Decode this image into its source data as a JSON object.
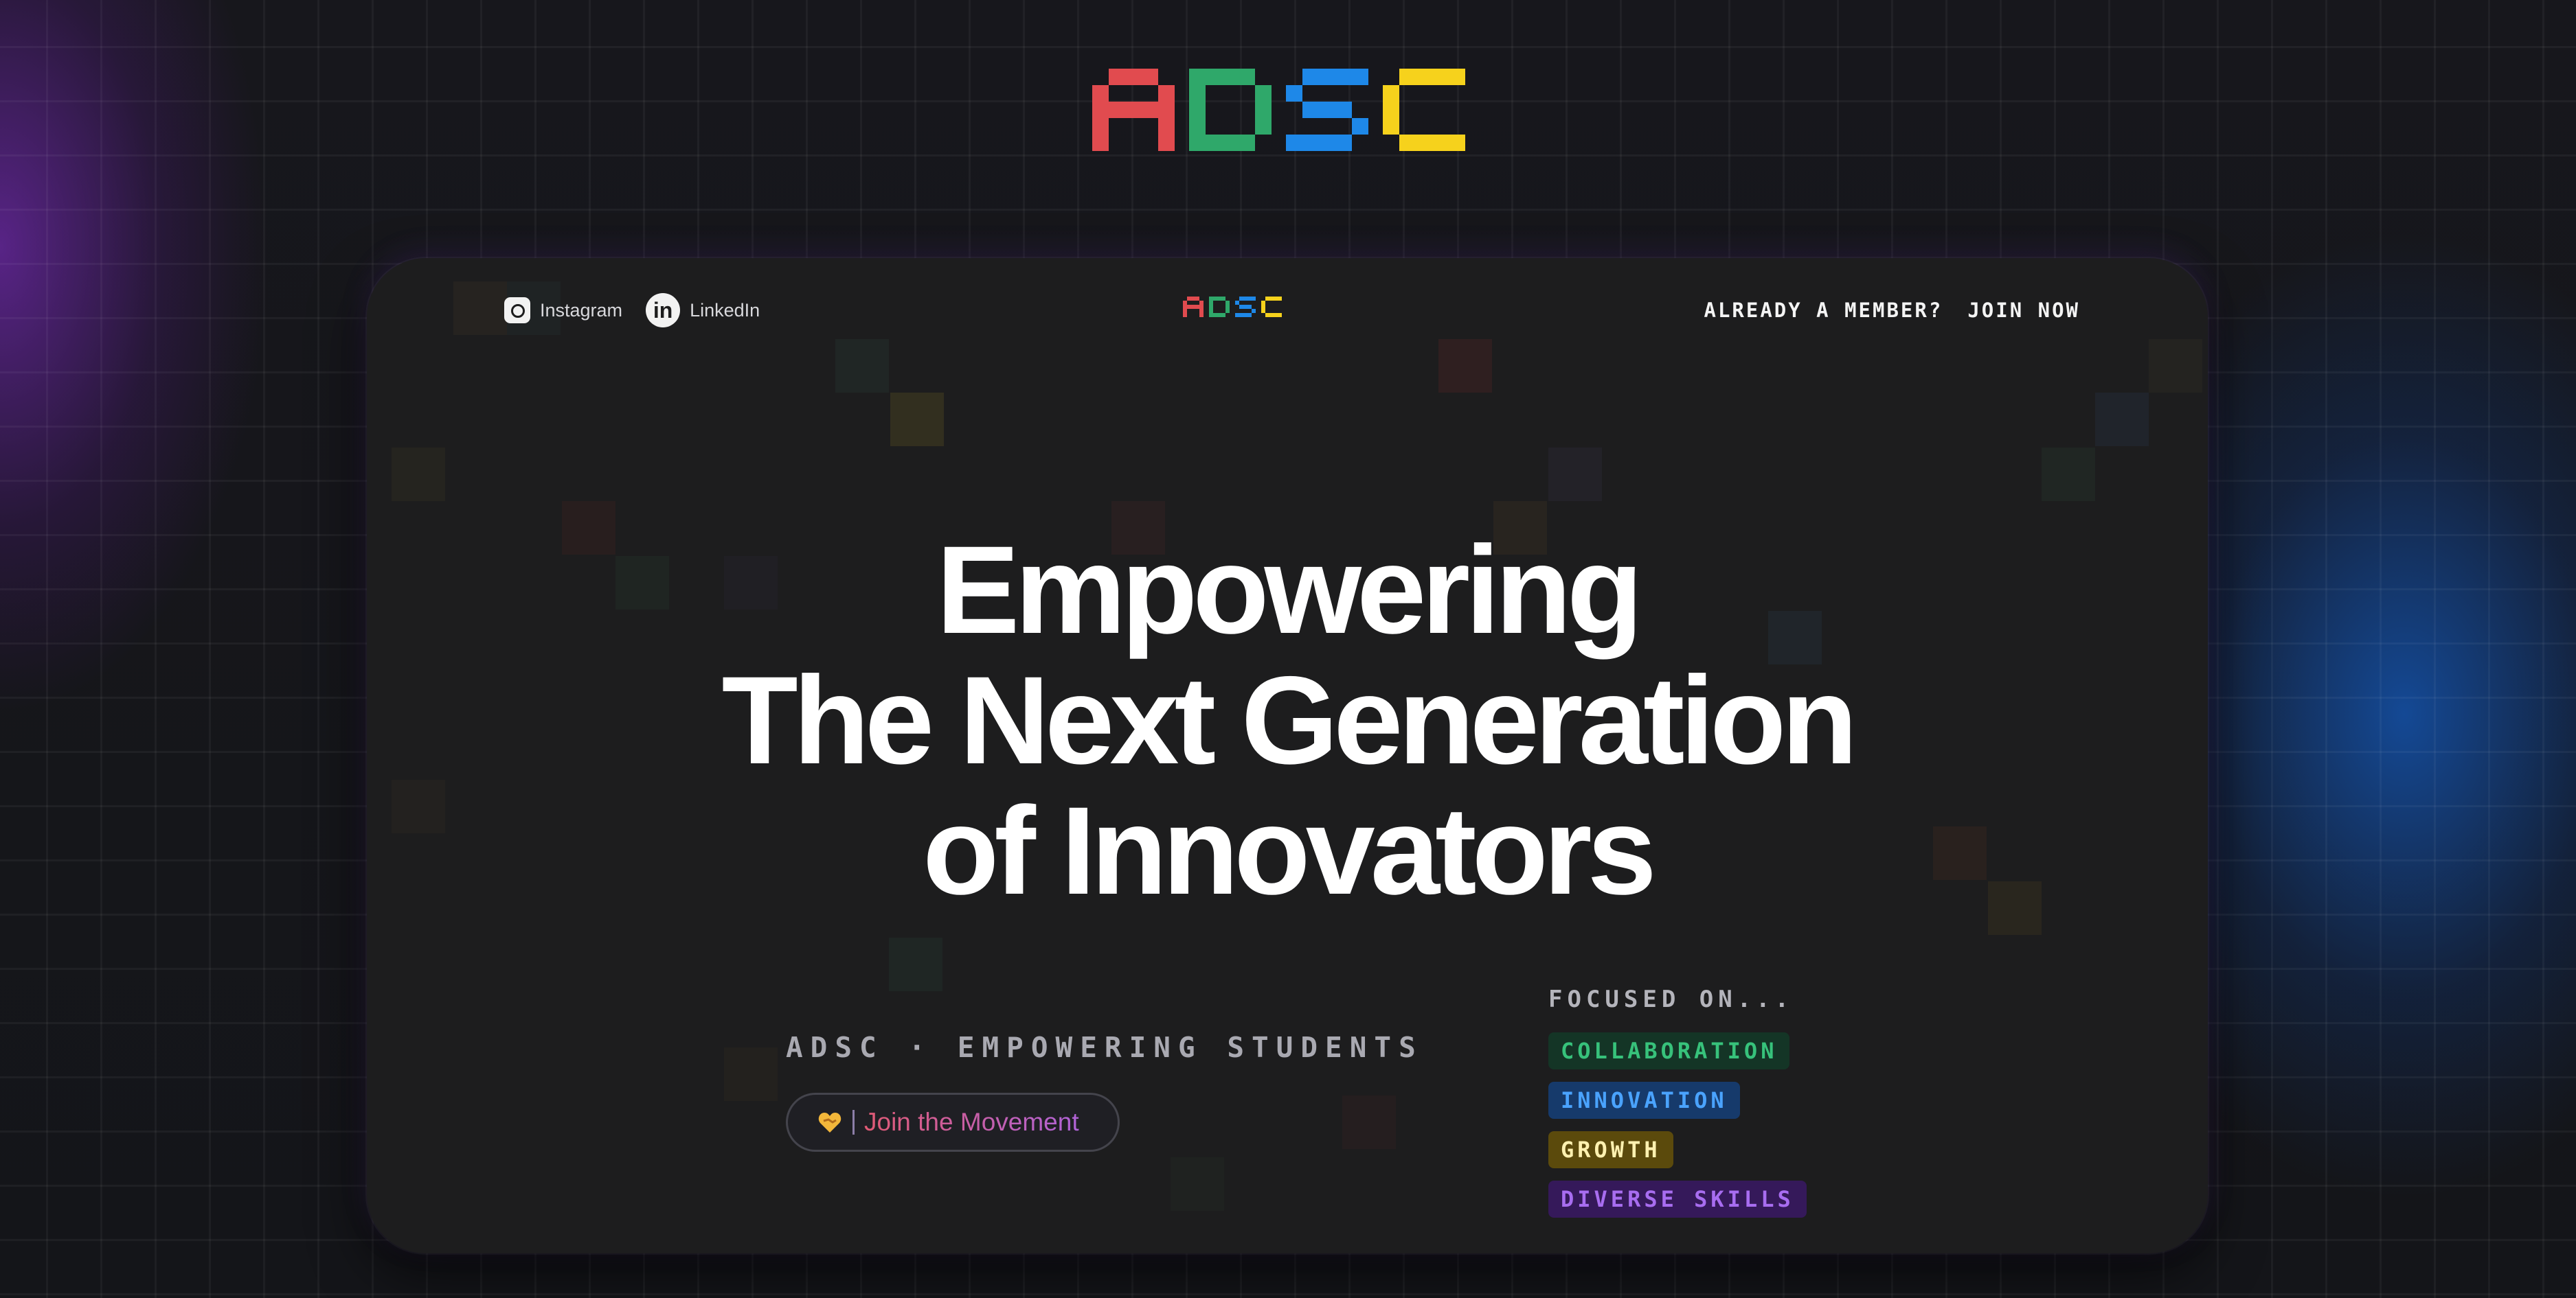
{
  "brand": {
    "logo_text": "ADSC",
    "letters": [
      "A",
      "D",
      "S",
      "C"
    ],
    "colors": [
      "#e14b4f",
      "#2fa86a",
      "#1e88e8",
      "#f6d21c"
    ]
  },
  "nav": {
    "social": [
      {
        "label": "Instagram",
        "icon": "instagram-icon"
      },
      {
        "label": "LinkedIn",
        "icon": "linkedin-icon"
      }
    ],
    "member_prompt": "ALREADY A MEMBER?",
    "join_label": "JOIN NOW"
  },
  "hero": {
    "lines": [
      "Empowering",
      "The Next Generation",
      "of Innovators"
    ]
  },
  "tagline": "ADSC · EMPOWERING STUDENTS",
  "cta": {
    "label": "Join the Movement",
    "icon": "heart-handshake-icon"
  },
  "focus": {
    "title": "FOCUSED ON...",
    "tags": [
      {
        "label": "COLLABORATION",
        "text_color": "#37c27b",
        "bg_color": "#143526"
      },
      {
        "label": "INNOVATION",
        "text_color": "#4aa3ff",
        "bg_color": "#163a6b"
      },
      {
        "label": "GROWTH",
        "text_color": "#fff1b0",
        "bg_color": "#5b4a0c"
      },
      {
        "label": "DIVERSE SKILLS",
        "text_color": "#a86df0",
        "bg_color": "#35195a"
      }
    ]
  }
}
